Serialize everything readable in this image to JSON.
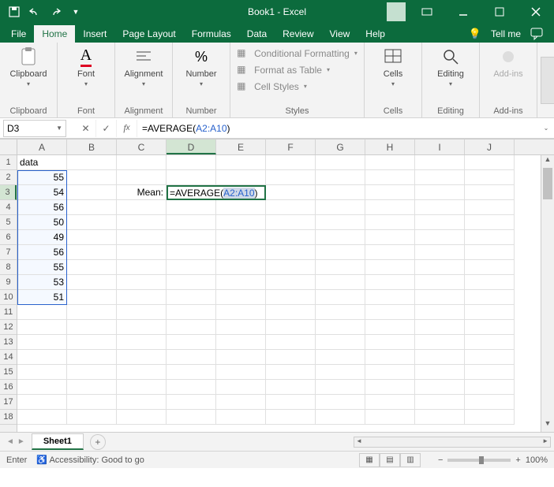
{
  "titlebar": {
    "title": "Book1 - Excel"
  },
  "tabs": {
    "file": "File",
    "home": "Home",
    "insert": "Insert",
    "pagelayout": "Page Layout",
    "formulas": "Formulas",
    "data": "Data",
    "review": "Review",
    "view": "View",
    "help": "Help",
    "tellme": "Tell me"
  },
  "ribbon": {
    "clipboard": "Clipboard",
    "font": "Font",
    "alignment": "Alignment",
    "number": "Number",
    "styles": "Styles",
    "cells": "Cells",
    "editing": "Editing",
    "addins": "Add-ins",
    "condfmt": "Conditional Formatting",
    "fmttable": "Format as Table",
    "cellstyles": "Cell Styles"
  },
  "namebox": "D3",
  "formula": {
    "prefix": "=AVERAGE(",
    "ref": "A2:A10",
    "suffix": ")"
  },
  "columns": [
    "A",
    "B",
    "C",
    "D",
    "E",
    "F",
    "G",
    "H",
    "I",
    "J"
  ],
  "data": {
    "A1": "data",
    "A2": "55",
    "A3": "54",
    "A4": "56",
    "A5": "50",
    "A6": "49",
    "A7": "56",
    "A8": "55",
    "A9": "53",
    "A10": "51",
    "C3": "Mean:"
  },
  "editing_cell": {
    "prefix": "=AVERAGE(",
    "ref": "A2:A10",
    "suffix": ")"
  },
  "sheet": {
    "name": "Sheet1"
  },
  "status": {
    "mode": "Enter",
    "accessibility": "Accessibility: Good to go",
    "zoom": "100%"
  }
}
